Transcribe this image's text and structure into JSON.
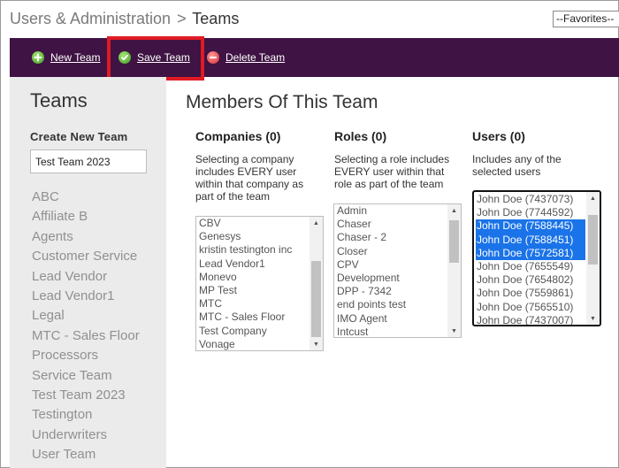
{
  "header": {
    "breadcrumb_root": "Users & Administration",
    "breadcrumb_sep": ">",
    "breadcrumb_current": "Teams",
    "favorites": "--Favorites--"
  },
  "toolbar": {
    "new_team": "New Team",
    "save_team": "Save Team",
    "delete_team": "Delete Team"
  },
  "sidebar": {
    "title": "Teams",
    "create_label": "Create New Team",
    "create_value": "Test Team 2023",
    "teams": [
      "ABC",
      "Affiliate B",
      "Agents",
      "Customer Service",
      "Lead Vendor",
      "Lead Vendor1",
      "Legal",
      "MTC - Sales Floor",
      "Processors",
      "Service Team",
      "Test Team 2023",
      "Testington",
      "Underwriters",
      "User Team"
    ]
  },
  "main": {
    "title": "Members Of This Team",
    "companies": {
      "heading": "Companies (0)",
      "description": "Selecting a company includes EVERY user within that company as part of the team",
      "options": [
        "CBV",
        "Genesys",
        "kristin testington inc",
        "Lead Vendor1",
        "Monevo",
        "MP Test",
        "MTC",
        "MTC - Sales Floor",
        "Test Company",
        "Vonage"
      ]
    },
    "roles": {
      "heading": "Roles (0)",
      "description": "Selecting a role includes EVERY user within that role as part of the team",
      "options": [
        "Admin",
        "Chaser",
        "Chaser - 2",
        "Closer",
        "CPV",
        "Development",
        "DPP - 7342",
        "end points test",
        "IMO Agent",
        "Intcust"
      ]
    },
    "users": {
      "heading": "Users (0)",
      "description": "Includes any of the selected users",
      "options": [
        {
          "label": "John Doe (7437073)",
          "selected": false
        },
        {
          "label": "John Doe (7744592)",
          "selected": false
        },
        {
          "label": "John Doe (7588445)",
          "selected": true
        },
        {
          "label": "John Doe (7588451)",
          "selected": true
        },
        {
          "label": "John Doe (7572581)",
          "selected": true
        },
        {
          "label": "John Doe (7655549)",
          "selected": false
        },
        {
          "label": "John Doe (7654802)",
          "selected": false
        },
        {
          "label": "John Doe (7559861)",
          "selected": false
        },
        {
          "label": "John Doe (7565510)",
          "selected": false
        },
        {
          "label": "John Doe (7437007)",
          "selected": false
        }
      ]
    }
  },
  "colors": {
    "toolbar_bg": "#3f1343",
    "highlight": "#e01b24",
    "selection": "#1a73e8",
    "sidebar_bg": "#ebebeb"
  },
  "icons": {
    "new_team": "plus-circle-icon",
    "save_team": "check-circle-icon",
    "delete_team": "minus-circle-icon"
  }
}
